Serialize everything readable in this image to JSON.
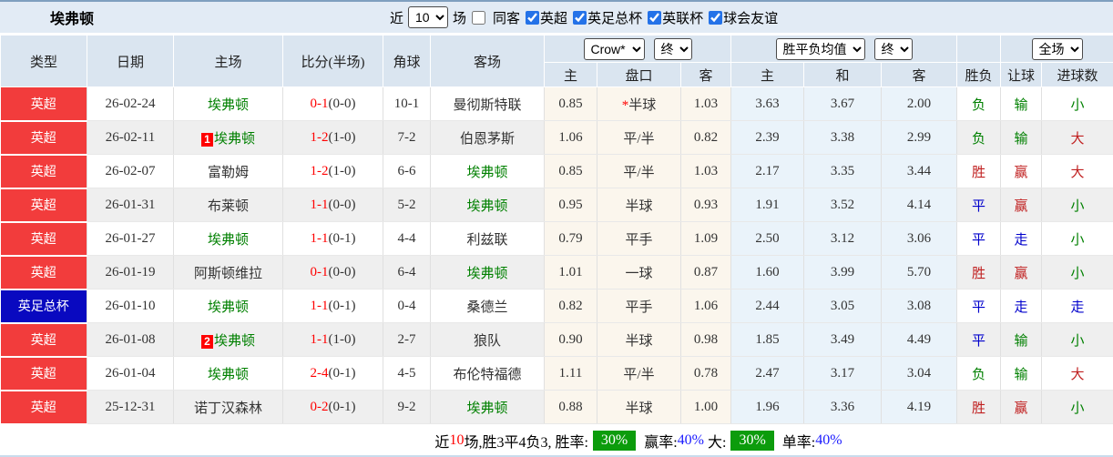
{
  "title": "埃弗顿",
  "toolbar": {
    "recent_label": "近",
    "recent_value": "10",
    "matches_label": "场",
    "same_venue": {
      "label": "同客",
      "checked": false
    },
    "competitions": [
      {
        "label": "英超",
        "checked": true
      },
      {
        "label": "英足总杯",
        "checked": true
      },
      {
        "label": "英联杯",
        "checked": true
      },
      {
        "label": "球会友谊",
        "checked": true
      }
    ]
  },
  "table": {
    "columns": {
      "type": "类型",
      "date": "日期",
      "home": "主场",
      "score": "比分(半场)",
      "corner": "角球",
      "away": "客场"
    },
    "dropdowns": {
      "odds_source": "Crow*",
      "odds_time_1": "终",
      "avg_label": "胜平负均值",
      "odds_time_2": "终",
      "scope": "全场"
    },
    "sub_headers": [
      "主",
      "盘口",
      "客",
      "主",
      "和",
      "客",
      "胜负",
      "让球",
      "进球数"
    ],
    "rows": [
      {
        "type": {
          "t": "英超",
          "c": "red"
        },
        "date": "26-02-24",
        "home": {
          "t": "埃弗顿",
          "ev": true
        },
        "score": {
          "ft": "0-1",
          "ht": "(0-0)"
        },
        "corner": "10-1",
        "away": {
          "t": "曼彻斯特联",
          "ev": false
        },
        "o1": "0.85",
        "pan": {
          "t": "半球",
          "star": true
        },
        "o2": "1.03",
        "a1": "3.63",
        "a2": "3.67",
        "a3": "2.00",
        "r1": {
          "t": "负",
          "c": "g"
        },
        "r2": {
          "t": "输",
          "c": "g"
        },
        "r3": {
          "t": "小",
          "c": "g"
        }
      },
      {
        "type": {
          "t": "英超",
          "c": "red"
        },
        "date": "26-02-11",
        "home": {
          "t": "埃弗顿",
          "ev": true,
          "badge": "1"
        },
        "score": {
          "ft": "1-2",
          "ht": "(1-0)"
        },
        "corner": "7-2",
        "away": {
          "t": "伯恩茅斯",
          "ev": false
        },
        "o1": "1.06",
        "pan": {
          "t": "平/半"
        },
        "o2": "0.82",
        "a1": "2.39",
        "a2": "3.38",
        "a3": "2.99",
        "r1": {
          "t": "负",
          "c": "g"
        },
        "r2": {
          "t": "输",
          "c": "g"
        },
        "r3": {
          "t": "大",
          "c": "r"
        }
      },
      {
        "type": {
          "t": "英超",
          "c": "red"
        },
        "date": "26-02-07",
        "home": {
          "t": "富勒姆",
          "ev": false
        },
        "score": {
          "ft": "1-2",
          "ht": "(1-0)"
        },
        "corner": "6-6",
        "away": {
          "t": "埃弗顿",
          "ev": true
        },
        "o1": "0.85",
        "pan": {
          "t": "平/半"
        },
        "o2": "1.03",
        "a1": "2.17",
        "a2": "3.35",
        "a3": "3.44",
        "r1": {
          "t": "胜",
          "c": "r"
        },
        "r2": {
          "t": "赢",
          "c": "r"
        },
        "r3": {
          "t": "大",
          "c": "r"
        }
      },
      {
        "type": {
          "t": "英超",
          "c": "red"
        },
        "date": "26-01-31",
        "home": {
          "t": "布莱顿",
          "ev": false
        },
        "score": {
          "ft": "1-1",
          "ht": "(0-0)"
        },
        "corner": "5-2",
        "away": {
          "t": "埃弗顿",
          "ev": true
        },
        "o1": "0.95",
        "pan": {
          "t": "半球"
        },
        "o2": "0.93",
        "a1": "1.91",
        "a2": "3.52",
        "a3": "4.14",
        "r1": {
          "t": "平",
          "c": "b"
        },
        "r2": {
          "t": "赢",
          "c": "r"
        },
        "r3": {
          "t": "小",
          "c": "g"
        }
      },
      {
        "type": {
          "t": "英超",
          "c": "red"
        },
        "date": "26-01-27",
        "home": {
          "t": "埃弗顿",
          "ev": true
        },
        "score": {
          "ft": "1-1",
          "ht": "(0-1)"
        },
        "corner": "4-4",
        "away": {
          "t": "利兹联",
          "ev": false
        },
        "o1": "0.79",
        "pan": {
          "t": "平手"
        },
        "o2": "1.09",
        "a1": "2.50",
        "a2": "3.12",
        "a3": "3.06",
        "r1": {
          "t": "平",
          "c": "b"
        },
        "r2": {
          "t": "走",
          "c": "b"
        },
        "r3": {
          "t": "小",
          "c": "g"
        }
      },
      {
        "type": {
          "t": "英超",
          "c": "red"
        },
        "date": "26-01-19",
        "home": {
          "t": "阿斯顿维拉",
          "ev": false
        },
        "score": {
          "ft": "0-1",
          "ht": "(0-0)"
        },
        "corner": "6-4",
        "away": {
          "t": "埃弗顿",
          "ev": true
        },
        "o1": "1.01",
        "pan": {
          "t": "一球"
        },
        "o2": "0.87",
        "a1": "1.60",
        "a2": "3.99",
        "a3": "5.70",
        "r1": {
          "t": "胜",
          "c": "r"
        },
        "r2": {
          "t": "赢",
          "c": "r"
        },
        "r3": {
          "t": "小",
          "c": "g"
        }
      },
      {
        "type": {
          "t": "英足总杯",
          "c": "blue"
        },
        "date": "26-01-10",
        "home": {
          "t": "埃弗顿",
          "ev": true
        },
        "score": {
          "ft": "1-1",
          "ht": "(0-1)"
        },
        "corner": "0-4",
        "away": {
          "t": "桑德兰",
          "ev": false
        },
        "o1": "0.82",
        "pan": {
          "t": "平手"
        },
        "o2": "1.06",
        "a1": "2.44",
        "a2": "3.05",
        "a3": "3.08",
        "r1": {
          "t": "平",
          "c": "b"
        },
        "r2": {
          "t": "走",
          "c": "b"
        },
        "r3": {
          "t": "走",
          "c": "b"
        }
      },
      {
        "type": {
          "t": "英超",
          "c": "red"
        },
        "date": "26-01-08",
        "home": {
          "t": "埃弗顿",
          "ev": true,
          "badge": "2"
        },
        "score": {
          "ft": "1-1",
          "ht": "(1-0)"
        },
        "corner": "2-7",
        "away": {
          "t": "狼队",
          "ev": false
        },
        "o1": "0.90",
        "pan": {
          "t": "半球"
        },
        "o2": "0.98",
        "a1": "1.85",
        "a2": "3.49",
        "a3": "4.49",
        "r1": {
          "t": "平",
          "c": "b"
        },
        "r2": {
          "t": "输",
          "c": "g"
        },
        "r3": {
          "t": "小",
          "c": "g"
        }
      },
      {
        "type": {
          "t": "英超",
          "c": "red"
        },
        "date": "26-01-04",
        "home": {
          "t": "埃弗顿",
          "ev": true
        },
        "score": {
          "ft": "2-4",
          "ht": "(0-1)"
        },
        "corner": "4-5",
        "away": {
          "t": "布伦特福德",
          "ev": false
        },
        "o1": "1.11",
        "pan": {
          "t": "平/半"
        },
        "o2": "0.78",
        "a1": "2.47",
        "a2": "3.17",
        "a3": "3.04",
        "r1": {
          "t": "负",
          "c": "g"
        },
        "r2": {
          "t": "输",
          "c": "g"
        },
        "r3": {
          "t": "大",
          "c": "r"
        }
      },
      {
        "type": {
          "t": "英超",
          "c": "red"
        },
        "date": "25-12-31",
        "home": {
          "t": "诺丁汉森林",
          "ev": false
        },
        "score": {
          "ft": "0-2",
          "ht": "(0-1)"
        },
        "corner": "9-2",
        "away": {
          "t": "埃弗顿",
          "ev": true
        },
        "o1": "0.88",
        "pan": {
          "t": "半球"
        },
        "o2": "1.00",
        "a1": "1.96",
        "a2": "3.36",
        "a3": "4.19",
        "r1": {
          "t": "胜",
          "c": "r"
        },
        "r2": {
          "t": "赢",
          "c": "r"
        },
        "r3": {
          "t": "小",
          "c": "g"
        }
      }
    ]
  },
  "footer": {
    "segments": [
      {
        "t": "近",
        "s": "plain"
      },
      {
        "t": "10",
        "s": "red"
      },
      {
        "t": "场,胜3平4负3, 胜率:",
        "s": "plain"
      },
      {
        "t": "30%",
        "s": "badge"
      },
      {
        "t": " 赢率:",
        "s": "plain"
      },
      {
        "t": "40%",
        "s": "blue"
      },
      {
        "t": " 大:",
        "s": "plain"
      },
      {
        "t": "30%",
        "s": "badge"
      },
      {
        "t": " 单率:",
        "s": "plain"
      },
      {
        "t": "40%",
        "s": "blue"
      }
    ]
  }
}
